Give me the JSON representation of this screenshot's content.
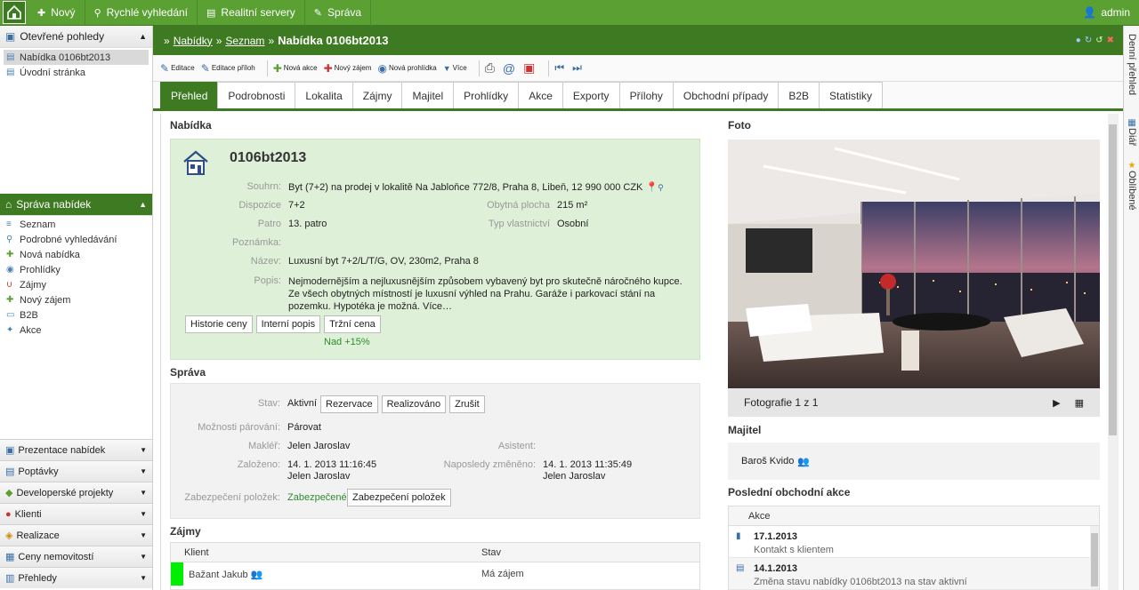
{
  "topbar": {
    "items": [
      "Nový",
      "Rychlé vyhledání",
      "Realitní servery",
      "Správa"
    ],
    "user": "admin"
  },
  "left": {
    "open_views_title": "Otevřené pohledy",
    "open_views": [
      "Nabídka 0106bt2013",
      "Úvodní stránka"
    ],
    "offers_title": "Správa nabídek",
    "offers_items": [
      "Seznam",
      "Podrobné vyhledávání",
      "Nová nabídka",
      "Prohlídky",
      "Zájmy",
      "Nový zájem",
      "B2B",
      "Akce"
    ],
    "footer_items": [
      "Prezentace nabídek",
      "Poptávky",
      "Developerské projekty",
      "Klienti",
      "Realizace",
      "Ceny nemovitostí",
      "Přehledy"
    ]
  },
  "header": {
    "crumb1": "Nabídky",
    "crumb2": "Seznam",
    "title": "Nabídka 0106bt2013"
  },
  "toolbar": [
    "Editace",
    "Editace příloh",
    "Nová akce",
    "Nový zájem",
    "Nová prohlídka",
    "Více"
  ],
  "tabs": [
    "Přehled",
    "Podrobnosti",
    "Lokalita",
    "Zájmy",
    "Majitel",
    "Prohlídky",
    "Akce",
    "Exporty",
    "Přílohy",
    "Obchodní případy",
    "B2B",
    "Statistiky"
  ],
  "offer": {
    "section_title": "Nabídka",
    "id": "0106bt2013",
    "souhrn_label": "Souhrn:",
    "souhrn": "Byt (7+2) na prodej v lokalitě Na Jabloňce 772/8, Praha 8, Libeň, 12 990 000 CZK",
    "dispozice_label": "Dispozice",
    "dispozice": "7+2",
    "plocha_label": "Obytná plocha",
    "plocha": "215 m²",
    "patro_label": "Patro",
    "patro": "13. patro",
    "vlastnictvi_label": "Typ vlastnictví",
    "vlastnictvi": "Osobní",
    "poznamka_label": "Poznámka:",
    "nazev_label": "Název:",
    "nazev": "Luxusní byt 7+2/L/T/G, OV, 230m2, Praha 8",
    "popis_label": "Popis:",
    "popis": "Nejmodernějším a nejluxusnějším způsobem vybavený byt pro skutečně náročného kupce. Ze všech obytných místností je luxusní výhled na Prahu. Garáže i parkovací stání na pozemku. Hypotéka je možná. Více…",
    "buttons": [
      "Historie ceny",
      "Interní popis",
      "Tržní cena"
    ],
    "market": "Nad +15%"
  },
  "sprava": {
    "section_title": "Správa",
    "stav_label": "Stav:",
    "stav": "Aktivní",
    "stav_buttons": [
      "Rezervace",
      "Realizováno",
      "Zrušit"
    ],
    "parovani_label": "Možnosti párování:",
    "parovani": "Párovat",
    "makler_label": "Makléř:",
    "makler": "Jelen Jaroslav",
    "asistent_label": "Asistent:",
    "zalozeno_label": "Založeno:",
    "zalozeno_date": "14. 1. 2013 11:16:45",
    "zalozeno_by": "Jelen Jaroslav",
    "zmeneno_label": "Naposledy změněno:",
    "zmeneno_date": "14. 1. 2013 11:35:49",
    "zmeneno_by": "Jelen Jaroslav",
    "zabezpeceni_label": "Zabezpečení položek:",
    "zabezpeceni": "Zabezpečené",
    "zabezpeceni_button": "Zabezpečení položek"
  },
  "zajmy": {
    "section_title": "Zájmy",
    "col_client": "Klient",
    "col_state": "Stav",
    "rows": [
      {
        "client": "Bažant Jakub",
        "state": "Má zájem"
      }
    ]
  },
  "foto": {
    "section_title": "Foto",
    "counter": "Fotografie 1 z 1"
  },
  "majitel": {
    "section_title": "Majitel",
    "name": "Baroš Kvido"
  },
  "akce": {
    "section_title": "Poslední obchodní akce",
    "col": "Akce",
    "rows": [
      {
        "date": "17.1.2013",
        "text": "Kontakt s klientem"
      },
      {
        "date": "14.1.2013",
        "text": "Změna stavu nabídky 0106bt2013 na stav aktivní"
      }
    ]
  },
  "sidepanel": [
    "Denní přehled",
    "Diář",
    "Oblíbené"
  ]
}
